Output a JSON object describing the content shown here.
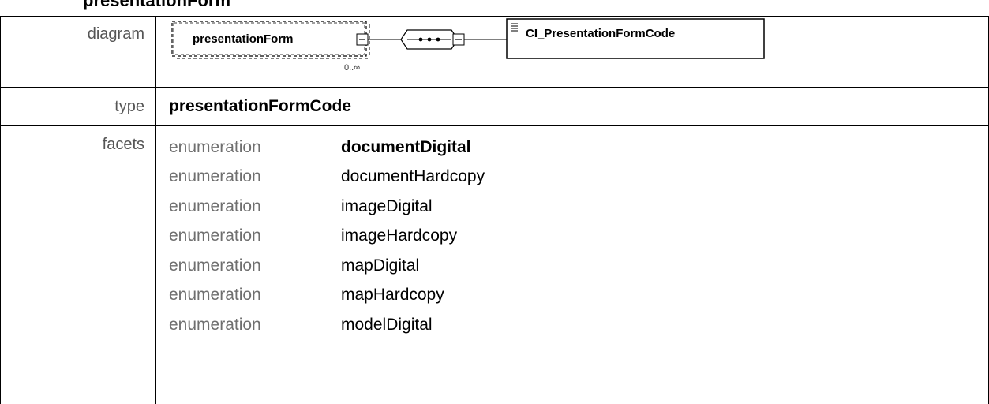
{
  "header": {
    "title": "presentationForm"
  },
  "rows": {
    "diagram_label": "diagram",
    "type_label": "type",
    "facets_label": "facets"
  },
  "diagram": {
    "element_name": "presentationForm",
    "cardinality": "0..∞",
    "type_name": "CI_PresentationFormCode"
  },
  "type_value": "presentationFormCode",
  "facets": [
    {
      "kind": "enumeration",
      "value": "documentDigital"
    },
    {
      "kind": "enumeration",
      "value": "documentHardcopy"
    },
    {
      "kind": "enumeration",
      "value": "imageDigital"
    },
    {
      "kind": "enumeration",
      "value": "imageHardcopy"
    },
    {
      "kind": "enumeration",
      "value": "mapDigital"
    },
    {
      "kind": "enumeration",
      "value": "mapHardcopy"
    },
    {
      "kind": "enumeration",
      "value": "modelDigital"
    }
  ]
}
